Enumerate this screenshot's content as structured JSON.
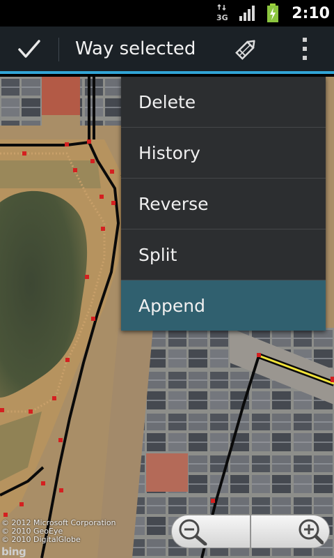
{
  "status_bar": {
    "time": "2:10",
    "network_label": "3G",
    "icons": [
      "network-3g-icon",
      "signal-strength-icon",
      "battery-charging-icon"
    ]
  },
  "action_bar": {
    "title": "Way selected",
    "icons": [
      "checkmark-icon",
      "pencil-icon",
      "overflow-menu-icon"
    ],
    "accent_color": "#32a5d6"
  },
  "menu": {
    "items": [
      {
        "label": "Delete"
      },
      {
        "label": "History"
      },
      {
        "label": "Reverse"
      },
      {
        "label": "Split"
      },
      {
        "label": "Append",
        "highlighted": true
      }
    ],
    "highlight_color": "#30606f"
  },
  "map": {
    "attribution": [
      "© 2012 Microsoft Corporation",
      "© 2010 GeoEye",
      "© 2010 DigitalGlobe"
    ],
    "provider_logo": "bing",
    "selected_way_color": "#f1e33a",
    "node_color": "#d42020"
  },
  "zoom_controls": {
    "icons": [
      "zoom-out-icon",
      "zoom-in-icon"
    ]
  }
}
